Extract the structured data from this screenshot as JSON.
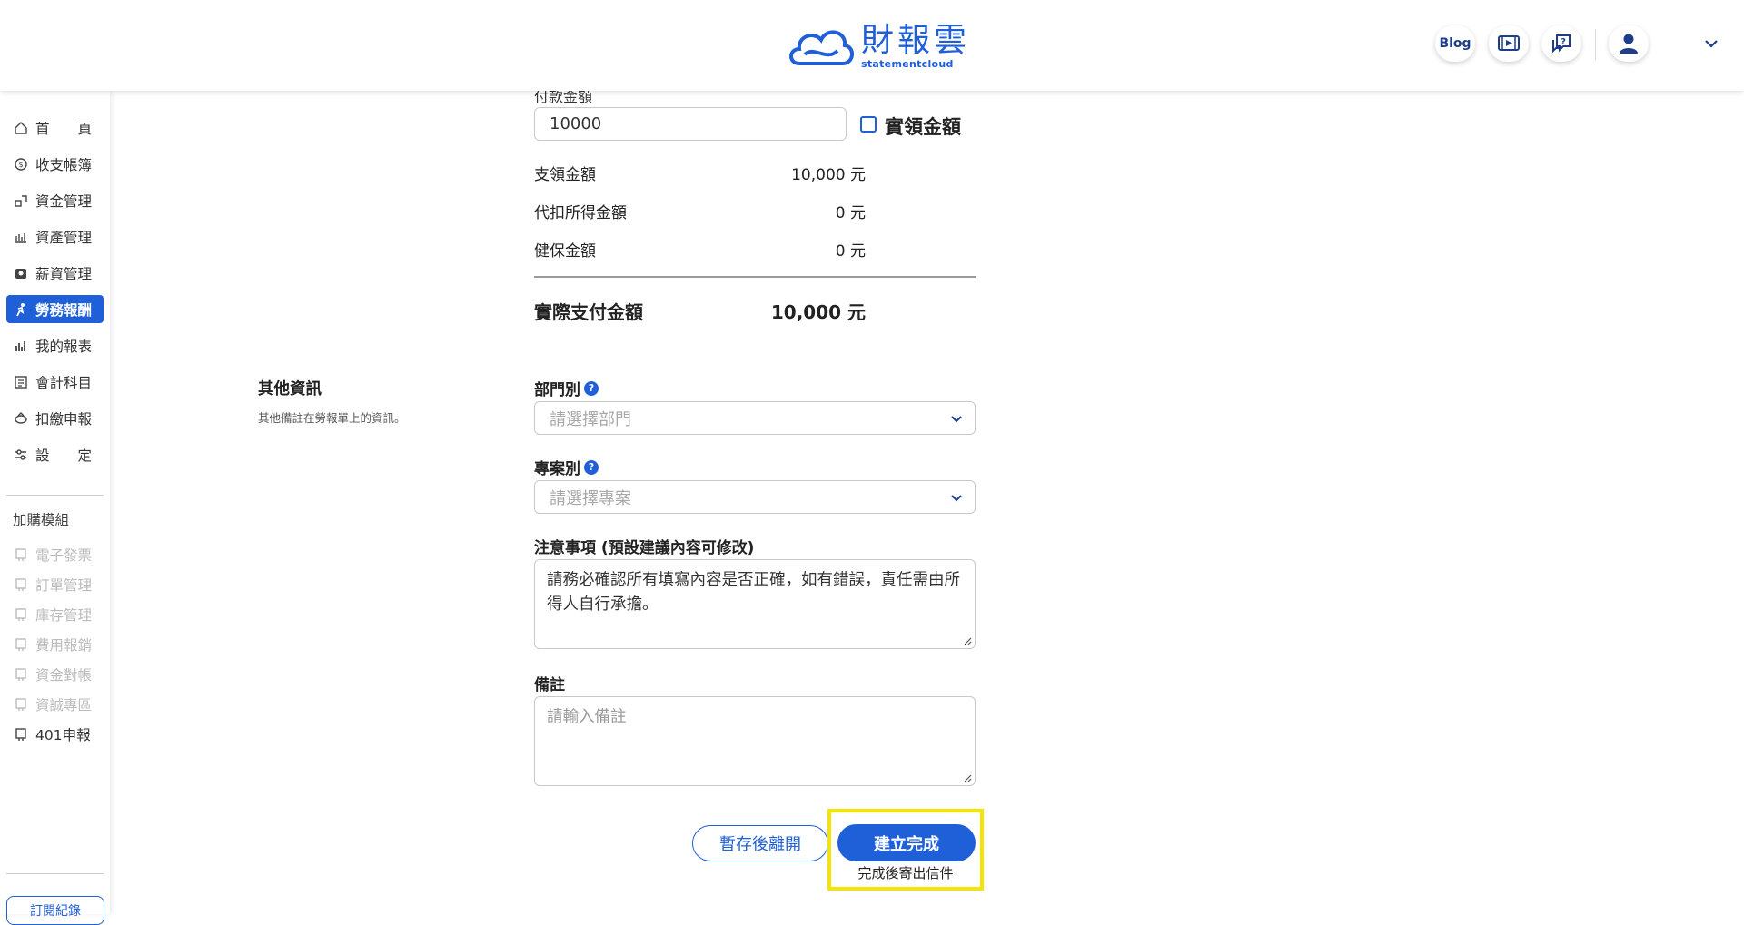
{
  "brand": {
    "name_cn": "財報雲",
    "name_en": "statementcloud",
    "color": "#1f5fd8"
  },
  "header": {
    "blog_label": "Blog",
    "icons": [
      "video-guide-icon",
      "help-chat-icon",
      "user-avatar-icon",
      "chevron-down-icon"
    ]
  },
  "sidebar": {
    "items": [
      {
        "label": "首　　頁",
        "icon": "home-icon"
      },
      {
        "label": "收支帳簿",
        "icon": "ledger-icon"
      },
      {
        "label": "資金管理",
        "icon": "funds-icon"
      },
      {
        "label": "資產管理",
        "icon": "assets-icon"
      },
      {
        "label": "薪資管理",
        "icon": "payroll-icon"
      },
      {
        "label": "勞務報酬",
        "icon": "labor-icon",
        "active": true
      },
      {
        "label": "我的報表",
        "icon": "report-icon"
      },
      {
        "label": "會計科目",
        "icon": "accounts-icon"
      },
      {
        "label": "扣繳申報",
        "icon": "tax-icon"
      },
      {
        "label": "設　　定",
        "icon": "settings-icon"
      }
    ],
    "addon_label": "加購模組",
    "addons": [
      {
        "label": "電子發票",
        "icon": "lock-icon"
      },
      {
        "label": "訂單管理",
        "icon": "lock-icon"
      },
      {
        "label": "庫存管理",
        "icon": "lock-icon"
      },
      {
        "label": "費用報銷",
        "icon": "lock-icon"
      },
      {
        "label": "資金對帳",
        "icon": "lock-icon"
      },
      {
        "label": "資誠專區",
        "icon": "lock-icon"
      },
      {
        "label": "401申報",
        "icon": "lock-icon"
      }
    ],
    "subscription_label": "訂閱紀錄"
  },
  "payment": {
    "amount_label": "付款金額",
    "amount_value": "10000",
    "actual_checkbox_label": "實領金額",
    "rows": [
      {
        "label": "支領金額",
        "value": "10,000 元"
      },
      {
        "label": "代扣所得金額",
        "value": "0 元"
      },
      {
        "label": "健保金額",
        "value": "0 元"
      }
    ],
    "total_label": "實際支付金額",
    "total_value": "10,000 元"
  },
  "other_info": {
    "title": "其他資訊",
    "subtitle": "其他備註在勞報單上的資訊。",
    "department_label": "部門別",
    "department_placeholder": "請選擇部門",
    "project_label": "專案別",
    "project_placeholder": "請選擇專案",
    "notice_label": "注意事項 (預設建議內容可修改)",
    "notice_value": "請務必確認所有填寫內容是否正確，如有錯誤，責任需由所得人自行承擔。",
    "remark_label": "備註",
    "remark_placeholder": "請輸入備註",
    "help_glyph": "?"
  },
  "actions": {
    "save_draft_label": "暫存後離開",
    "create_label": "建立完成",
    "create_note": "完成後寄出信件"
  }
}
